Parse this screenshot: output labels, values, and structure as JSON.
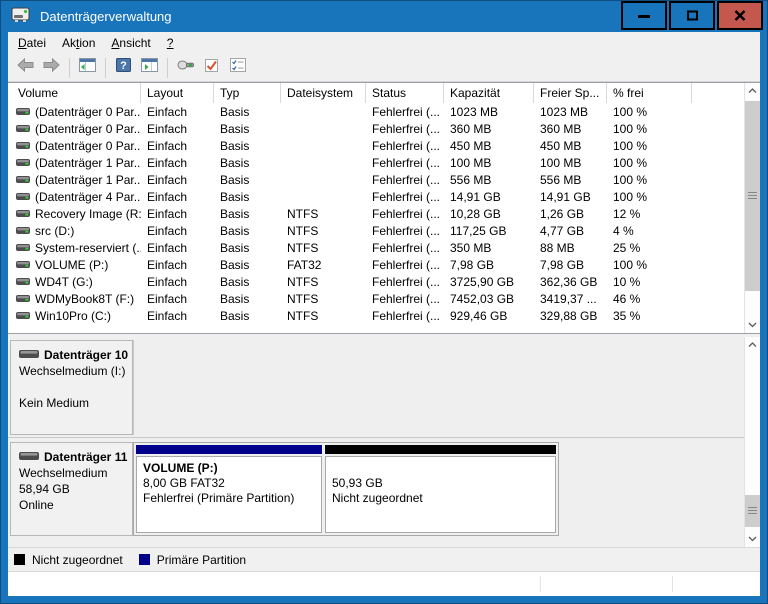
{
  "window": {
    "title": "Datenträgerverwaltung"
  },
  "menu": {
    "items": [
      {
        "label": "Datei",
        "underline_index": 0
      },
      {
        "label": "Aktion",
        "underline_index": 2
      },
      {
        "label": "Ansicht",
        "underline_index": 0
      },
      {
        "label": "?",
        "underline_index": 0
      }
    ]
  },
  "toolbar": {
    "items": [
      "back",
      "forward",
      "separator",
      "console-tree",
      "separator",
      "help",
      "action-pane",
      "separator",
      "properties",
      "check",
      "tasklist"
    ]
  },
  "volume_list": {
    "columns": [
      "Volume",
      "Layout",
      "Typ",
      "Dateisystem",
      "Status",
      "Kapazität",
      "Freier Sp...",
      "% frei"
    ],
    "rows": [
      [
        "(Datenträger 0 Par...",
        "Einfach",
        "Basis",
        "",
        "Fehlerfrei (...",
        "1023 MB",
        "1023 MB",
        "100 %"
      ],
      [
        "(Datenträger 0 Par...",
        "Einfach",
        "Basis",
        "",
        "Fehlerfrei (...",
        "360 MB",
        "360 MB",
        "100 %"
      ],
      [
        "(Datenträger 0 Par...",
        "Einfach",
        "Basis",
        "",
        "Fehlerfrei (...",
        "450 MB",
        "450 MB",
        "100 %"
      ],
      [
        "(Datenträger 1 Par...",
        "Einfach",
        "Basis",
        "",
        "Fehlerfrei (...",
        "100 MB",
        "100 MB",
        "100 %"
      ],
      [
        "(Datenträger 1 Par...",
        "Einfach",
        "Basis",
        "",
        "Fehlerfrei (...",
        "556 MB",
        "556 MB",
        "100 %"
      ],
      [
        "(Datenträger 4 Par...",
        "Einfach",
        "Basis",
        "",
        "Fehlerfrei (...",
        "14,91 GB",
        "14,91 GB",
        "100 %"
      ],
      [
        "Recovery Image (R:)",
        "Einfach",
        "Basis",
        "NTFS",
        "Fehlerfrei (...",
        "10,28 GB",
        "1,26 GB",
        "12 %"
      ],
      [
        "src (D:)",
        "Einfach",
        "Basis",
        "NTFS",
        "Fehlerfrei (...",
        "117,25 GB",
        "4,77 GB",
        "4 %"
      ],
      [
        "System-reserviert (...",
        "Einfach",
        "Basis",
        "NTFS",
        "Fehlerfrei (...",
        "350 MB",
        "88 MB",
        "25 %"
      ],
      [
        "VOLUME (P:)",
        "Einfach",
        "Basis",
        "FAT32",
        "Fehlerfrei (...",
        "7,98 GB",
        "7,98 GB",
        "100 %"
      ],
      [
        "WD4T (G:)",
        "Einfach",
        "Basis",
        "NTFS",
        "Fehlerfrei (...",
        "3725,90 GB",
        "362,36 GB",
        "10 %"
      ],
      [
        "WDMyBook8T (F:)",
        "Einfach",
        "Basis",
        "NTFS",
        "Fehlerfrei (...",
        "7452,03 GB",
        "3419,37 ...",
        "46 %"
      ],
      [
        "Win10Pro (C:)",
        "Einfach",
        "Basis",
        "NTFS",
        "Fehlerfrei (...",
        "929,46 GB",
        "329,88 GB",
        "35 %"
      ]
    ]
  },
  "disks": [
    {
      "name": "Datenträger 10",
      "lines": [
        "Wechselmedium (I:)",
        "",
        "Kein Medium"
      ],
      "partitions": []
    },
    {
      "name": "Datenträger 11",
      "lines": [
        "Wechselmedium",
        "58,94 GB",
        "Online"
      ],
      "partitions": [
        {
          "name": "VOLUME  (P:)",
          "size_fs": "8,00 GB FAT32",
          "status": "Fehlerfrei (Primäre Partition)",
          "type": "primary",
          "color": "#00008b"
        },
        {
          "name": "",
          "size_fs": "50,93 GB",
          "status": "Nicht zugeordnet",
          "type": "unallocated",
          "color": "#000000"
        }
      ]
    }
  ],
  "legend": {
    "items": [
      {
        "label": "Nicht zugeordnet",
        "color": "#000000"
      },
      {
        "label": "Primäre Partition",
        "color": "#00008b"
      }
    ]
  },
  "colors": {
    "titlebar": "#1874bb",
    "close_button": "#c4574e",
    "primary_partition": "#00008b",
    "unallocated": "#000000"
  }
}
